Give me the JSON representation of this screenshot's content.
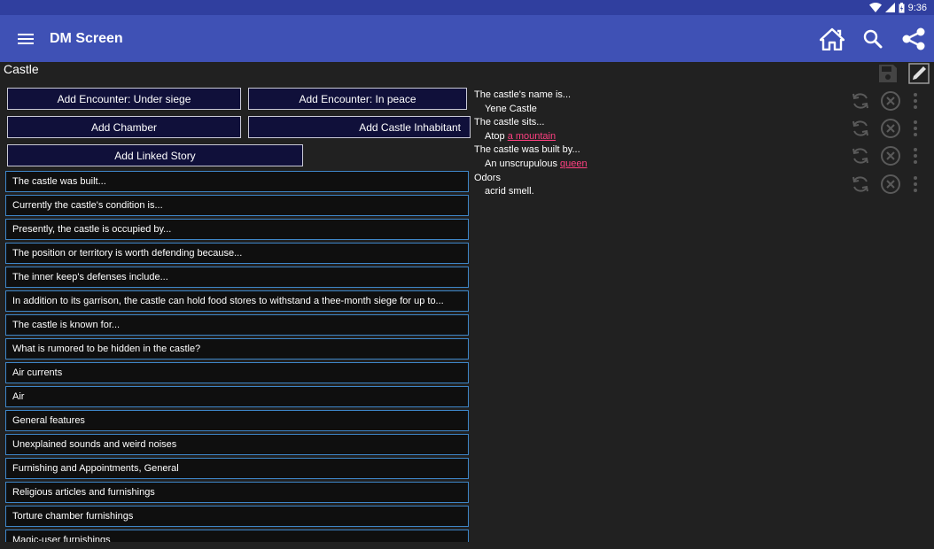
{
  "status": {
    "time": "9:36"
  },
  "appbar": {
    "title": "DM Screen"
  },
  "page": {
    "title": "Castle"
  },
  "buttons": {
    "encounter_siege": "Add Encounter: Under siege",
    "encounter_peace": "Add Encounter: In peace",
    "chamber": "Add Chamber",
    "inhabitant": "Add Castle Inhabitant",
    "linked_story": "Add Linked Story"
  },
  "list": [
    "The castle was built...",
    "Currently the castle's condition is...",
    "Presently, the castle is occupied by...",
    "The position or territory is worth defending because...",
    "The inner keep's defenses include...",
    "In addition to its garrison, the castle can hold food stores to withstand a thee-month siege for up to...",
    "The castle is known for...",
    "What is rumored to be hidden in the castle?",
    "Air currents",
    "Air",
    "General features",
    "Unexplained sounds and weird noises",
    "Furnishing and Appointments, General",
    "Religious articles and furnishings",
    "Torture chamber furnishings",
    "Magic-user furnishings"
  ],
  "details": [
    {
      "q": "The castle's name is...",
      "a_pre": "Yene Castle",
      "a_link": ""
    },
    {
      "q": "The castle sits...",
      "a_pre": "Atop ",
      "a_link": "a mountain"
    },
    {
      "q": "The castle was built by...",
      "a_pre": "An unscrupulous ",
      "a_link": "queen"
    },
    {
      "q": "Odors",
      "a_pre": "acrid smell.",
      "a_link": ""
    }
  ],
  "colors": {
    "appbar": "#3f51b5",
    "statusbar": "#303f9f",
    "link": "#ff4081",
    "list_border": "#3e86c8"
  }
}
